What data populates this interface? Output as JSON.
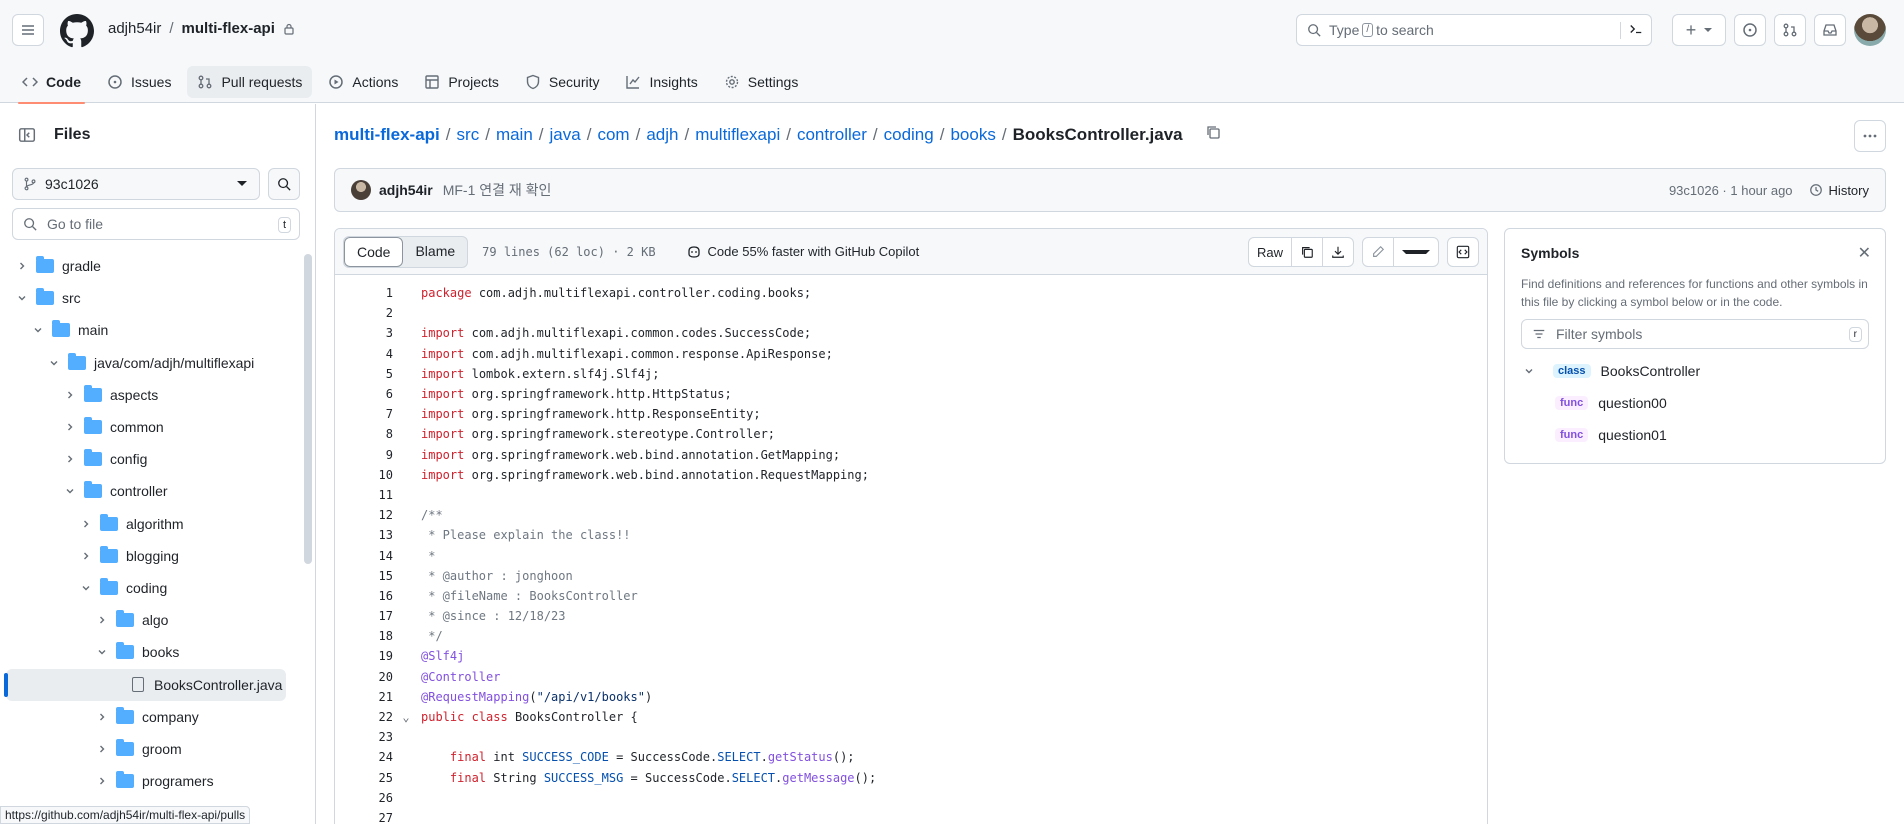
{
  "header": {
    "owner": "adjh54ir",
    "separator": "/",
    "repo": "multi-flex-api",
    "search_pre": "Type",
    "search_key": "/",
    "search_post": "to search",
    "plus_label": "+"
  },
  "nav": {
    "items": [
      {
        "label": "Code",
        "icon": "code-icon"
      },
      {
        "label": "Issues",
        "icon": "issue-opened-icon"
      },
      {
        "label": "Pull requests",
        "icon": "git-pull-request-icon"
      },
      {
        "label": "Actions",
        "icon": "play-icon"
      },
      {
        "label": "Projects",
        "icon": "table-icon"
      },
      {
        "label": "Security",
        "icon": "shield-icon"
      },
      {
        "label": "Insights",
        "icon": "graph-icon"
      },
      {
        "label": "Settings",
        "icon": "gear-icon"
      }
    ]
  },
  "sidebar": {
    "title": "Files",
    "branch": "93c1026",
    "goto_placeholder": "Go to file",
    "goto_key": "t",
    "tree": [
      {
        "label": "gradle",
        "type": "folder",
        "depth": 0,
        "open": false
      },
      {
        "label": "src",
        "type": "folder",
        "depth": 0,
        "open": true
      },
      {
        "label": "main",
        "type": "folder",
        "depth": 1,
        "open": true
      },
      {
        "label": "java/com/adjh/multiflexapi",
        "type": "folder",
        "depth": 2,
        "open": true
      },
      {
        "label": "aspects",
        "type": "folder",
        "depth": 3,
        "open": false
      },
      {
        "label": "common",
        "type": "folder",
        "depth": 3,
        "open": false
      },
      {
        "label": "config",
        "type": "folder",
        "depth": 3,
        "open": false
      },
      {
        "label": "controller",
        "type": "folder",
        "depth": 3,
        "open": true
      },
      {
        "label": "algorithm",
        "type": "folder",
        "depth": 4,
        "open": false
      },
      {
        "label": "blogging",
        "type": "folder",
        "depth": 4,
        "open": false
      },
      {
        "label": "coding",
        "type": "folder",
        "depth": 4,
        "open": true
      },
      {
        "label": "algo",
        "type": "folder",
        "depth": 5,
        "open": false
      },
      {
        "label": "books",
        "type": "folder",
        "depth": 5,
        "open": true
      },
      {
        "label": "BooksController.java",
        "type": "file",
        "depth": 6,
        "selected": true
      },
      {
        "label": "company",
        "type": "folder",
        "depth": 5,
        "open": false
      },
      {
        "label": "groom",
        "type": "folder",
        "depth": 5,
        "open": false
      },
      {
        "label": "programers",
        "type": "folder",
        "depth": 5,
        "open": false
      }
    ]
  },
  "status_url": "https://github.com/adjh54ir/multi-flex-api/pulls",
  "breadcrumb": {
    "parts": [
      "multi-flex-api",
      "src",
      "main",
      "java",
      "com",
      "adjh",
      "multiflexapi",
      "controller",
      "coding",
      "books"
    ],
    "current": "BooksController.java"
  },
  "commit": {
    "author": "adjh54ir",
    "message": "MF-1 연결 재 확인",
    "meta": "93c1026 · 1 hour ago",
    "history_label": "History"
  },
  "code_view": {
    "tab_code": "Code",
    "tab_blame": "Blame",
    "info": "79 lines (62 loc) · 2 KB",
    "copilot": "Code 55% faster with GitHub Copilot",
    "raw_label": "Raw",
    "lines": [
      [
        [
          "kw",
          "package"
        ],
        [
          "",
          "com.adjh.multiflexapi.controller.coding.books;"
        ]
      ],
      [],
      [
        [
          "kw",
          "import"
        ],
        [
          "",
          "com.adjh.multiflexapi.common.codes.SuccessCode;"
        ]
      ],
      [
        [
          "kw",
          "import"
        ],
        [
          "",
          "com.adjh.multiflexapi.common.response.ApiResponse;"
        ]
      ],
      [
        [
          "kw",
          "import"
        ],
        [
          "",
          "lombok.extern.slf4j.Slf4j;"
        ]
      ],
      [
        [
          "kw",
          "import"
        ],
        [
          "",
          "org.springframework.http.HttpStatus;"
        ]
      ],
      [
        [
          "kw",
          "import"
        ],
        [
          "",
          "org.springframework.http.ResponseEntity;"
        ]
      ],
      [
        [
          "kw",
          "import"
        ],
        [
          "",
          "org.springframework.stereotype.Controller;"
        ]
      ],
      [
        [
          "kw",
          "import"
        ],
        [
          "",
          "org.springframework.web.bind.annotation.GetMapping;"
        ]
      ],
      [
        [
          "kw",
          "import"
        ],
        [
          "",
          "org.springframework.web.bind.annotation.RequestMapping;"
        ]
      ],
      [],
      [
        [
          "cm",
          "/**"
        ]
      ],
      [
        [
          "cm",
          " * Please explain the class!!"
        ]
      ],
      [
        [
          "cm",
          " *"
        ]
      ],
      [
        [
          "cm",
          " * @author : jonghoon"
        ]
      ],
      [
        [
          "cm",
          " * @fileName : BooksController"
        ]
      ],
      [
        [
          "cm",
          " * @since : 12/18/23"
        ]
      ],
      [
        [
          "cm",
          " */"
        ]
      ],
      [
        [
          "an",
          "@Slf4j"
        ]
      ],
      [
        [
          "an",
          "@Controller"
        ]
      ],
      [
        [
          "an",
          "@RequestMapping"
        ],
        [
          "",
          "("
        ],
        [
          "str",
          "\"/api/v1/books\""
        ],
        [
          "",
          ")"
        ]
      ],
      [
        [
          "kw",
          "public class"
        ],
        [
          "",
          "BooksController {"
        ]
      ],
      [],
      [
        [
          "",
          "    "
        ],
        [
          "kw",
          "final"
        ],
        [
          "",
          " int "
        ],
        [
          "fld",
          "SUCCESS_CODE"
        ],
        [
          "",
          " = SuccessCode."
        ],
        [
          "fld",
          "SELECT"
        ],
        [
          "",
          "."
        ],
        [
          "an",
          "getStatus"
        ],
        [
          "",
          "();"
        ]
      ],
      [
        [
          "",
          "    "
        ],
        [
          "kw",
          "final"
        ],
        [
          "",
          " String "
        ],
        [
          "fld",
          "SUCCESS_MSG"
        ],
        [
          "",
          " = SuccessCode."
        ],
        [
          "fld",
          "SELECT"
        ],
        [
          "",
          "."
        ],
        [
          "an",
          "getMessage"
        ],
        [
          "",
          "();"
        ]
      ],
      [],
      []
    ]
  },
  "symbols": {
    "title": "Symbols",
    "description": "Find definitions and references for functions and other symbols in this file by clicking a symbol below or in the code.",
    "filter_placeholder": "Filter symbols",
    "filter_key": "r",
    "items": [
      {
        "kind": "class",
        "name": "BooksController"
      },
      {
        "kind": "func",
        "name": "question00"
      },
      {
        "kind": "func",
        "name": "question01"
      }
    ]
  }
}
